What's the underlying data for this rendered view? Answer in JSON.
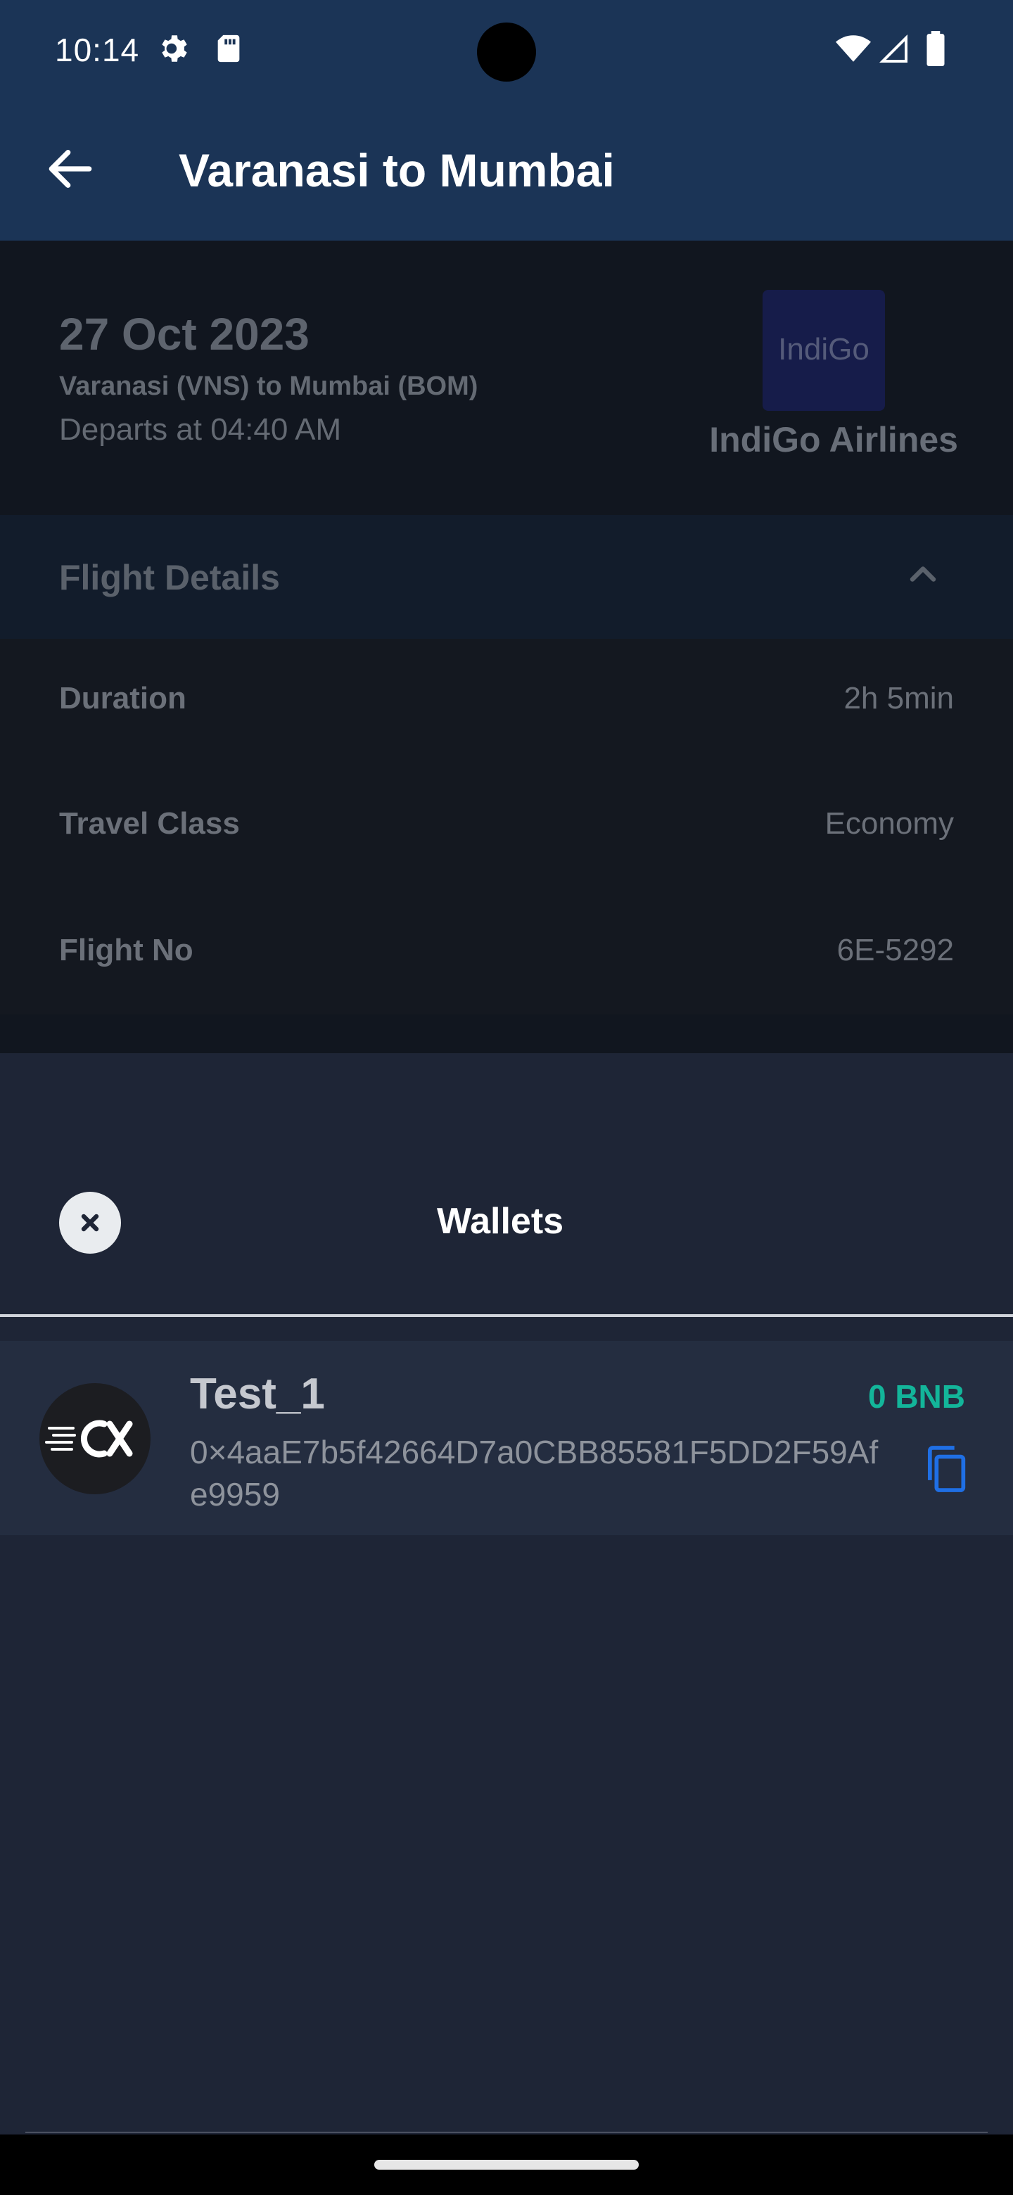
{
  "status_bar": {
    "time": "10:14",
    "icons": [
      "settings-icon",
      "sd-card-icon",
      "wifi-icon",
      "signal-icon",
      "battery-icon"
    ]
  },
  "app_bar": {
    "title": "Varanasi to Mumbai",
    "back_icon": "arrow-left-icon"
  },
  "flight": {
    "date": "27 Oct 2023",
    "route": "Varanasi  (VNS) to Mumbai  (BOM)",
    "departs": "Departs at 04:40 AM",
    "airline_logo_text": "IndiGo",
    "airline_name": "IndiGo Airlines"
  },
  "flight_details": {
    "title": "Flight Details",
    "chevron_icon": "chevron-up-icon",
    "rows": [
      {
        "label": "Duration",
        "value": "2h 5min"
      },
      {
        "label": "Travel Class",
        "value": "Economy"
      },
      {
        "label": "Flight No",
        "value": "6E-5292"
      }
    ]
  },
  "wallets_sheet": {
    "title": "Wallets",
    "close_icon": "close-icon",
    "wallets": [
      {
        "name": "Test_1",
        "balance": "0 BNB",
        "address": "0×4aaE7b5f42664D7a0CBB85581F5DD2F59Afe9959",
        "copy_icon": "copy-icon"
      }
    ]
  },
  "colors": {
    "app_bar": "#1b3456",
    "sheet_bg": "#1e2536",
    "balance": "#13b59a",
    "copy_icon": "#1f6fe5"
  }
}
